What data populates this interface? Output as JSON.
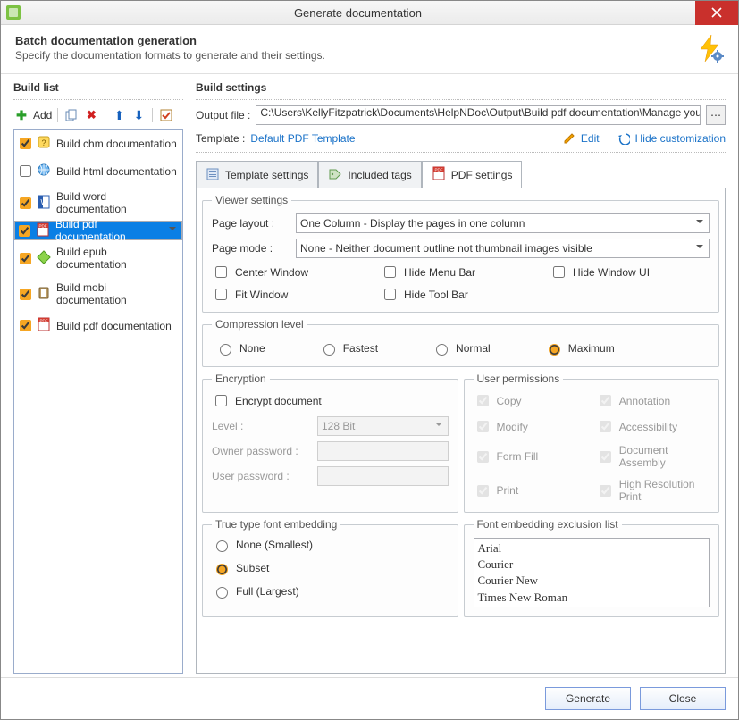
{
  "title": "Generate documentation",
  "banner": {
    "heading": "Batch documentation generation",
    "sub": "Specify the documentation formats to generate and their settings."
  },
  "left": {
    "heading": "Build list",
    "add_label": "Add",
    "items": [
      {
        "checked": true,
        "label": "Build chm documentation",
        "icon": "chm"
      },
      {
        "checked": false,
        "label": "Build html documentation",
        "icon": "html"
      },
      {
        "checked": true,
        "label": "Build word documentation",
        "icon": "word"
      },
      {
        "checked": true,
        "label": "Build pdf documentation",
        "icon": "pdf",
        "selected": true
      },
      {
        "checked": true,
        "label": "Build epub documentation",
        "icon": "epub"
      },
      {
        "checked": true,
        "label": "Build mobi documentation",
        "icon": "mobi"
      },
      {
        "checked": true,
        "label": "Build pdf documentation",
        "icon": "pdf"
      }
    ]
  },
  "right": {
    "heading": "Build settings",
    "output_label": "Output file :",
    "output_value": "C:\\Users\\KellyFitzpatrick\\Documents\\HelpNDoc\\Output\\Build pdf documentation\\Manage your Table of C",
    "template_label": "Template :",
    "template_name": "Default PDF Template",
    "edit_label": "Edit",
    "hide_label": "Hide customization",
    "tabs": [
      {
        "label": "Template settings",
        "icon": "tmpl"
      },
      {
        "label": "Included tags",
        "icon": "tags"
      },
      {
        "label": "PDF settings",
        "icon": "pdf",
        "active": true
      }
    ],
    "viewer": {
      "legend": "Viewer settings",
      "page_layout_label": "Page layout :",
      "page_layout_value": "One Column - Display the pages in one column",
      "page_mode_label": "Page mode :",
      "page_mode_value": "None - Neither document outline not thumbnail images visible",
      "checks": [
        "Center Window",
        "Hide Menu Bar",
        "Hide Window UI",
        "Fit Window",
        "Hide Tool Bar"
      ]
    },
    "compression": {
      "legend": "Compression level",
      "options": [
        "None",
        "Fastest",
        "Normal",
        "Maximum"
      ],
      "selected": "Maximum"
    },
    "encryption": {
      "legend": "Encryption",
      "encrypt_label": "Encrypt document",
      "level_label": "Level :",
      "level_value": "128 Bit",
      "owner_label": "Owner password :",
      "user_label": "User password :"
    },
    "permissions": {
      "legend": "User permissions",
      "items": [
        "Copy",
        "Annotation",
        "Modify",
        "Accessibility",
        "Form Fill",
        "Document Assembly",
        "Print",
        "High Resolution Print"
      ]
    },
    "fontembed": {
      "legend": "True type font embedding",
      "options": [
        "None (Smallest)",
        "Subset",
        "Full (Largest)"
      ],
      "selected": "Subset"
    },
    "fontexcl": {
      "legend": "Font embedding exclusion list",
      "items": [
        "Arial",
        "Courier",
        "Courier New",
        "Times New Roman"
      ]
    }
  },
  "footer": {
    "generate": "Generate",
    "close": "Close"
  }
}
